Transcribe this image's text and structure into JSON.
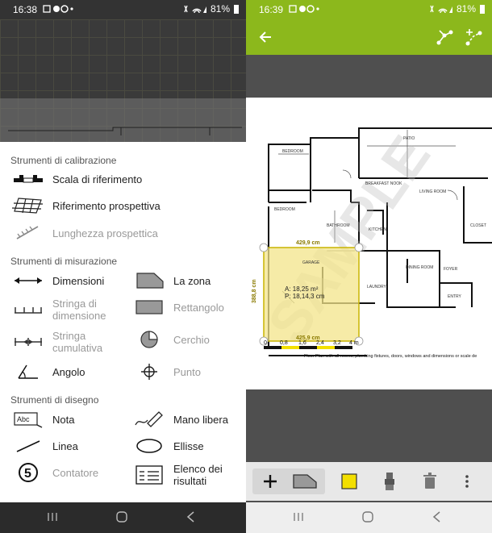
{
  "left": {
    "status": {
      "time": "16:38",
      "battery": "81%"
    },
    "sections": [
      {
        "title": "Strumenti di calibrazione"
      },
      {
        "title": "Strumenti di misurazione"
      },
      {
        "title": "Strumenti di disegno"
      }
    ],
    "tools": {
      "scala": "Scala di riferimento",
      "prospettiva": "Riferimento prospettiva",
      "lunghezza": "Lunghezza prospettica",
      "dimensioni": "Dimensioni",
      "stringa_dim_1": "Stringa di",
      "stringa_dim_2": "dimensione",
      "stringa_cum_1": "Stringa",
      "stringa_cum_2": "cumulativa",
      "angolo": "Angolo",
      "zona": "La zona",
      "rettangolo": "Rettangolo",
      "cerchio": "Cerchio",
      "punto": "Punto",
      "nota": "Nota",
      "linea": "Linea",
      "contatore": "Contatore",
      "mano": "Mano libera",
      "ellisse": "Ellisse",
      "elenco_1": "Elenco dei",
      "elenco_2": "risultati"
    },
    "icon_text": {
      "abc": "Abc",
      "counter": "5"
    }
  },
  "right": {
    "status": {
      "time": "16:39",
      "battery": "81%"
    },
    "plan": {
      "garage_area": "A: 18,25 m²",
      "garage_perimeter": "P: 18,14,3 cm",
      "dim_top": "429,9 cm",
      "dim_left": "388,8 cm",
      "dim_bottom": "425,9 cm",
      "scale_0": "0",
      "scale_1": "0,8",
      "scale_2": "1,6",
      "scale_3": "2,4",
      "scale_4": "3,2",
      "scale_5": "4 m",
      "caption": "Floor Plan with all rooms, plumbing fixtures, doors, windows and dimensions or scale de",
      "watermark": "SAMPLE",
      "rooms": [
        "BEDROOM",
        "PATIO",
        "BEDROOM",
        "LIVING ROOM",
        "GARAGE",
        "DINING ROOM",
        "KITCHEN",
        "BATHROOM",
        "BREAKFAST NOOK",
        "CLOSET",
        "FOYER",
        "LAUNDRY",
        "ENTRY"
      ]
    },
    "accent": "#8cb81c",
    "shape_color": "#f3df00"
  }
}
